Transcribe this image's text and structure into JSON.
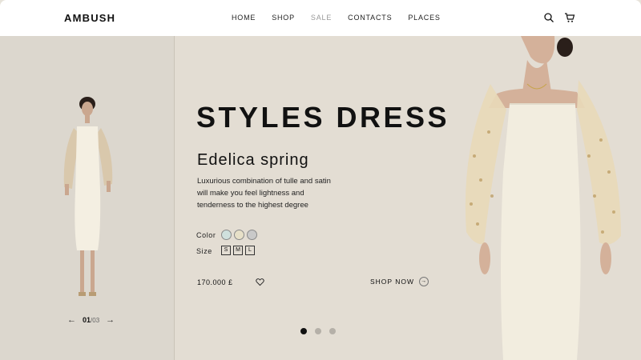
{
  "header": {
    "brand": "AMBUSH",
    "nav": [
      "HOME",
      "SHOP",
      "SALE",
      "CONTACTS",
      "PLACES"
    ],
    "active_nav": "SALE",
    "icons": [
      "search-icon",
      "cart-icon"
    ]
  },
  "left": {
    "slide_current": "01",
    "slide_total": "/03"
  },
  "hero": {
    "title": "STYLES DRESS",
    "subtitle": "Edelica spring",
    "description": "Luxurious combination of tulle and satin will make you feel lightness and tenderness to the highest degree",
    "color_label": "Color",
    "colors": [
      "#cfe0dd",
      "#e7e0c8",
      "#c9c9c9"
    ],
    "size_label": "Size",
    "sizes": [
      "S",
      "M",
      "L"
    ],
    "price": "170.000 £",
    "cta": "SHOP NOW",
    "pagination_count": 3,
    "pagination_active": 0
  },
  "colors": {
    "left_bg": "#dcd7ce",
    "hero_bg": "#e3ddd3",
    "accent": "#111111"
  }
}
